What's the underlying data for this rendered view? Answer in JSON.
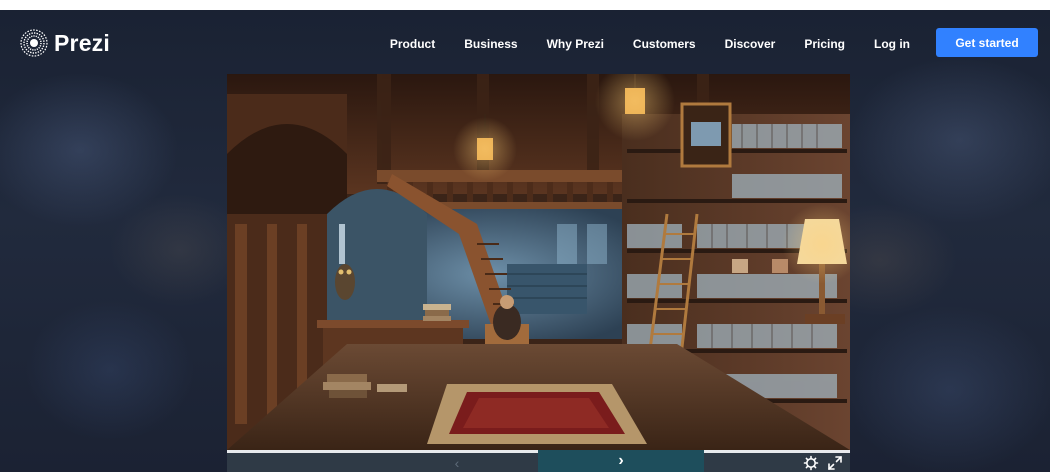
{
  "brand": {
    "name": "Prezi",
    "logo_icon": "prezi-logo-icon"
  },
  "nav": {
    "items": [
      {
        "label": "Product"
      },
      {
        "label": "Business"
      },
      {
        "label": "Why Prezi"
      },
      {
        "label": "Customers"
      },
      {
        "label": "Discover"
      },
      {
        "label": "Pricing"
      },
      {
        "label": "Log in"
      }
    ],
    "cta_label": "Get started"
  },
  "presentation": {
    "scene": "library-illustration",
    "controls": {
      "prev_icon": "chevron-left-icon",
      "prev_glyph": "‹",
      "next_icon": "chevron-right-icon",
      "next_glyph": "›",
      "settings_icon": "gear-icon",
      "fullscreen_icon": "fullscreen-icon"
    }
  },
  "colors": {
    "background": "#1f2738",
    "accent": "#3181ff",
    "control_bar": "#2f3a46",
    "next_button": "#1e4e5c"
  }
}
